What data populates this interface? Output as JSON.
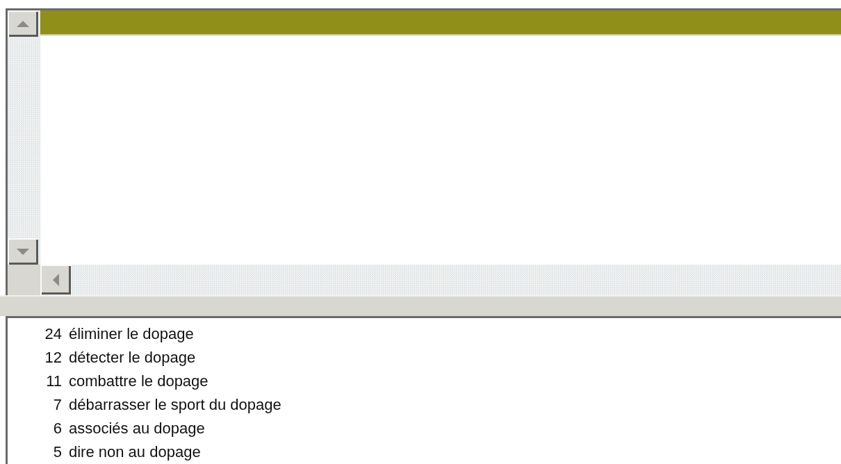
{
  "results": [
    {
      "count": "24",
      "phrase": "éliminer le dopage"
    },
    {
      "count": "12",
      "phrase": "détecter le dopage"
    },
    {
      "count": "11",
      "phrase": "combattre le dopage"
    },
    {
      "count": "7",
      "phrase": "débarrasser le sport du dopage"
    },
    {
      "count": "6",
      "phrase": "associés au dopage"
    },
    {
      "count": "5",
      "phrase": "dire non au dopage"
    }
  ]
}
